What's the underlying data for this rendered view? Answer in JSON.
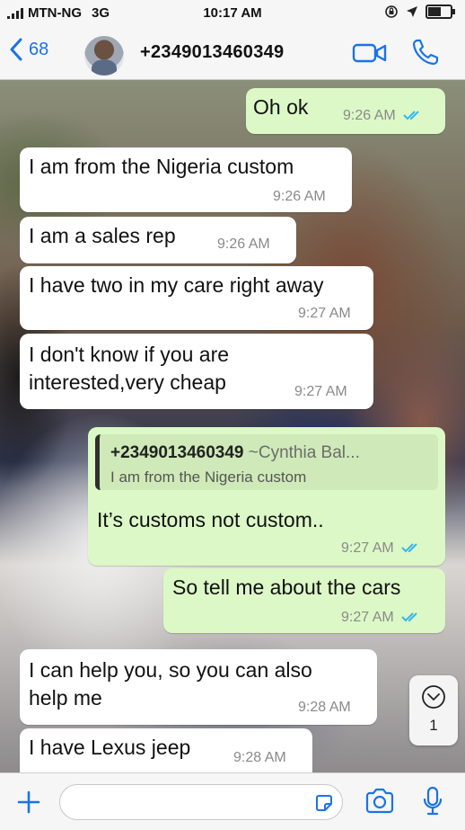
{
  "status": {
    "carrier": "MTN-NG",
    "network": "3G",
    "time": "10:17 AM"
  },
  "header": {
    "back_count": "68",
    "contact": "+2349013460349",
    "icons": [
      "back-chevron-icon",
      "video-call-icon",
      "phone-call-icon"
    ]
  },
  "messages": [
    {
      "dir": "out",
      "text": "Oh ok",
      "time": "9:26 AM",
      "read": true
    },
    {
      "dir": "in",
      "text": "I am from the Nigeria custom",
      "time": "9:26 AM"
    },
    {
      "dir": "in",
      "text": "I am a sales rep",
      "time": "9:26 AM"
    },
    {
      "dir": "in",
      "text": "I have two in my care right away",
      "time": "9:27 AM"
    },
    {
      "dir": "in",
      "text": "I don't know if you are\ninterested,very cheap",
      "time": "9:27 AM"
    },
    {
      "dir": "out",
      "quote": {
        "name": "+2349013460349",
        "author": "~Cynthia Bal...",
        "text": "I am from the Nigeria custom"
      },
      "text": "It’s customs not custom..",
      "time": "9:27 AM",
      "read": true
    },
    {
      "dir": "out",
      "text": "So tell me about the cars",
      "time": "9:27 AM",
      "read": true
    },
    {
      "dir": "in",
      "text": "I can help you, so you can also\nhelp me",
      "time": "9:28 AM"
    },
    {
      "dir": "in",
      "text": "I have Lexus jeep",
      "time": "9:28 AM"
    }
  ],
  "scroll_badge": {
    "count": "1"
  },
  "input": {
    "placeholder": ""
  },
  "colors": {
    "accent": "#1a73e8",
    "outgoing_bubble": "#dcf8c6",
    "incoming_bubble": "#ffffff",
    "read_ticks": "#34b7f1"
  }
}
